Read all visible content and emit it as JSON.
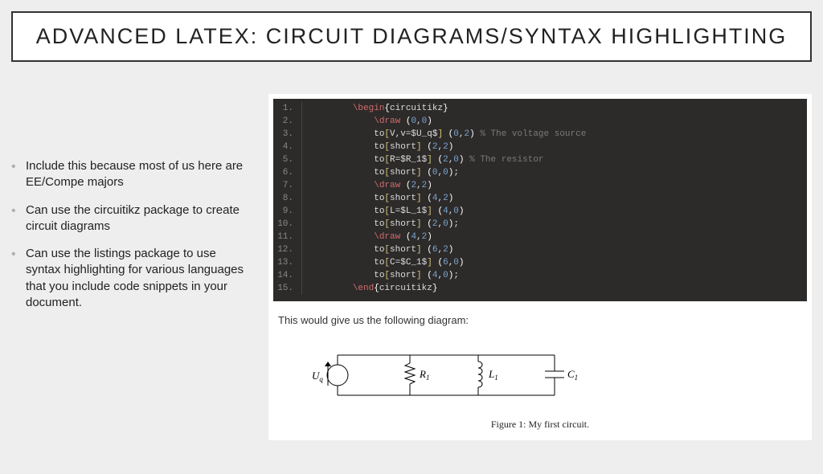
{
  "title": "ADVANCED LATEX: CIRCUIT DIAGRAMS/SYNTAX HIGHLIGHTING",
  "bullets": [
    "Include this because most of us here are EE/Compe majors",
    "Can use the circuitikz package to create circuit diagrams",
    "Can use the listings package to use syntax highlighting for various languages that you include code snippets in your document."
  ],
  "code": {
    "lines": [
      {
        "n": "1.",
        "indent": 2,
        "tokens": [
          [
            "cmd",
            "\\begin"
          ],
          [
            "brc",
            "{"
          ],
          [
            "txt",
            "circuitikz"
          ],
          [
            "brc",
            "}"
          ]
        ]
      },
      {
        "n": "2.",
        "indent": 3,
        "tokens": [
          [
            "cmd",
            "\\draw "
          ],
          [
            "paren",
            "("
          ],
          [
            "num",
            "0"
          ],
          [
            "txt",
            ","
          ],
          [
            "num",
            "0"
          ],
          [
            "paren",
            ")"
          ]
        ]
      },
      {
        "n": "3.",
        "indent": 3,
        "tokens": [
          [
            "txt",
            "to"
          ],
          [
            "brk",
            "["
          ],
          [
            "txt",
            "V,v=$U_q$"
          ],
          [
            "brk",
            "]"
          ],
          [
            "txt",
            " "
          ],
          [
            "paren",
            "("
          ],
          [
            "num",
            "0"
          ],
          [
            "txt",
            ","
          ],
          [
            "num",
            "2"
          ],
          [
            "paren",
            ")"
          ],
          [
            "cm",
            " % The voltage source"
          ]
        ]
      },
      {
        "n": "4.",
        "indent": 3,
        "tokens": [
          [
            "txt",
            "to"
          ],
          [
            "brk",
            "["
          ],
          [
            "txt",
            "short"
          ],
          [
            "brk",
            "]"
          ],
          [
            "txt",
            " "
          ],
          [
            "paren",
            "("
          ],
          [
            "num",
            "2"
          ],
          [
            "txt",
            ","
          ],
          [
            "num",
            "2"
          ],
          [
            "paren",
            ")"
          ]
        ]
      },
      {
        "n": "5.",
        "indent": 3,
        "tokens": [
          [
            "txt",
            "to"
          ],
          [
            "brk",
            "["
          ],
          [
            "txt",
            "R=$R_1$"
          ],
          [
            "brk",
            "]"
          ],
          [
            "txt",
            " "
          ],
          [
            "paren",
            "("
          ],
          [
            "num",
            "2"
          ],
          [
            "txt",
            ","
          ],
          [
            "num",
            "0"
          ],
          [
            "paren",
            ")"
          ],
          [
            "cm",
            " % The resistor"
          ]
        ]
      },
      {
        "n": "6.",
        "indent": 3,
        "tokens": [
          [
            "txt",
            "to"
          ],
          [
            "brk",
            "["
          ],
          [
            "txt",
            "short"
          ],
          [
            "brk",
            "]"
          ],
          [
            "txt",
            " "
          ],
          [
            "paren",
            "("
          ],
          [
            "num",
            "0"
          ],
          [
            "txt",
            ","
          ],
          [
            "num",
            "0"
          ],
          [
            "paren",
            ")"
          ],
          [
            "txt",
            ";"
          ]
        ]
      },
      {
        "n": "7.",
        "indent": 3,
        "tokens": [
          [
            "cmd",
            "\\draw "
          ],
          [
            "paren",
            "("
          ],
          [
            "num",
            "2"
          ],
          [
            "txt",
            ","
          ],
          [
            "num",
            "2"
          ],
          [
            "paren",
            ")"
          ]
        ]
      },
      {
        "n": "8.",
        "indent": 3,
        "tokens": [
          [
            "txt",
            "to"
          ],
          [
            "brk",
            "["
          ],
          [
            "txt",
            "short"
          ],
          [
            "brk",
            "]"
          ],
          [
            "txt",
            " "
          ],
          [
            "paren",
            "("
          ],
          [
            "num",
            "4"
          ],
          [
            "txt",
            ","
          ],
          [
            "num",
            "2"
          ],
          [
            "paren",
            ")"
          ]
        ]
      },
      {
        "n": "9.",
        "indent": 3,
        "tokens": [
          [
            "txt",
            "to"
          ],
          [
            "brk",
            "["
          ],
          [
            "txt",
            "L=$L_1$"
          ],
          [
            "brk",
            "]"
          ],
          [
            "txt",
            " "
          ],
          [
            "paren",
            "("
          ],
          [
            "num",
            "4"
          ],
          [
            "txt",
            ","
          ],
          [
            "num",
            "0"
          ],
          [
            "paren",
            ")"
          ]
        ]
      },
      {
        "n": "10.",
        "indent": 3,
        "tokens": [
          [
            "txt",
            "to"
          ],
          [
            "brk",
            "["
          ],
          [
            "txt",
            "short"
          ],
          [
            "brk",
            "]"
          ],
          [
            "txt",
            " "
          ],
          [
            "paren",
            "("
          ],
          [
            "num",
            "2"
          ],
          [
            "txt",
            ","
          ],
          [
            "num",
            "0"
          ],
          [
            "paren",
            ")"
          ],
          [
            "txt",
            ";"
          ]
        ]
      },
      {
        "n": "11.",
        "indent": 3,
        "tokens": [
          [
            "cmd",
            "\\draw "
          ],
          [
            "paren",
            "("
          ],
          [
            "num",
            "4"
          ],
          [
            "txt",
            ","
          ],
          [
            "num",
            "2"
          ],
          [
            "paren",
            ")"
          ]
        ]
      },
      {
        "n": "12.",
        "indent": 3,
        "tokens": [
          [
            "txt",
            "to"
          ],
          [
            "brk",
            "["
          ],
          [
            "txt",
            "short"
          ],
          [
            "brk",
            "]"
          ],
          [
            "txt",
            " "
          ],
          [
            "paren",
            "("
          ],
          [
            "num",
            "6"
          ],
          [
            "txt",
            ","
          ],
          [
            "num",
            "2"
          ],
          [
            "paren",
            ")"
          ]
        ]
      },
      {
        "n": "13.",
        "indent": 3,
        "tokens": [
          [
            "txt",
            "to"
          ],
          [
            "brk",
            "["
          ],
          [
            "txt",
            "C=$C_1$"
          ],
          [
            "brk",
            "]"
          ],
          [
            "txt",
            " "
          ],
          [
            "paren",
            "("
          ],
          [
            "num",
            "6"
          ],
          [
            "txt",
            ","
          ],
          [
            "num",
            "0"
          ],
          [
            "paren",
            ")"
          ]
        ]
      },
      {
        "n": "14.",
        "indent": 3,
        "tokens": [
          [
            "txt",
            "to"
          ],
          [
            "brk",
            "["
          ],
          [
            "txt",
            "short"
          ],
          [
            "brk",
            "]"
          ],
          [
            "txt",
            " "
          ],
          [
            "paren",
            "("
          ],
          [
            "num",
            "4"
          ],
          [
            "txt",
            ","
          ],
          [
            "num",
            "0"
          ],
          [
            "paren",
            ")"
          ],
          [
            "txt",
            ";"
          ]
        ]
      },
      {
        "n": "15.",
        "indent": 2,
        "tokens": [
          [
            "cmd",
            "\\end"
          ],
          [
            "brc",
            "{"
          ],
          [
            "txt",
            "circuitikz"
          ],
          [
            "brc",
            "}"
          ]
        ]
      }
    ]
  },
  "caption_between": "This would give us the following diagram:",
  "figure_caption": "Figure 1: My first circuit.",
  "circuit_labels": {
    "Uq": "U",
    "Uq_sub": "q",
    "R": "R",
    "R_sub": "1",
    "L": "L",
    "L_sub": "1",
    "C": "C",
    "C_sub": "1"
  }
}
